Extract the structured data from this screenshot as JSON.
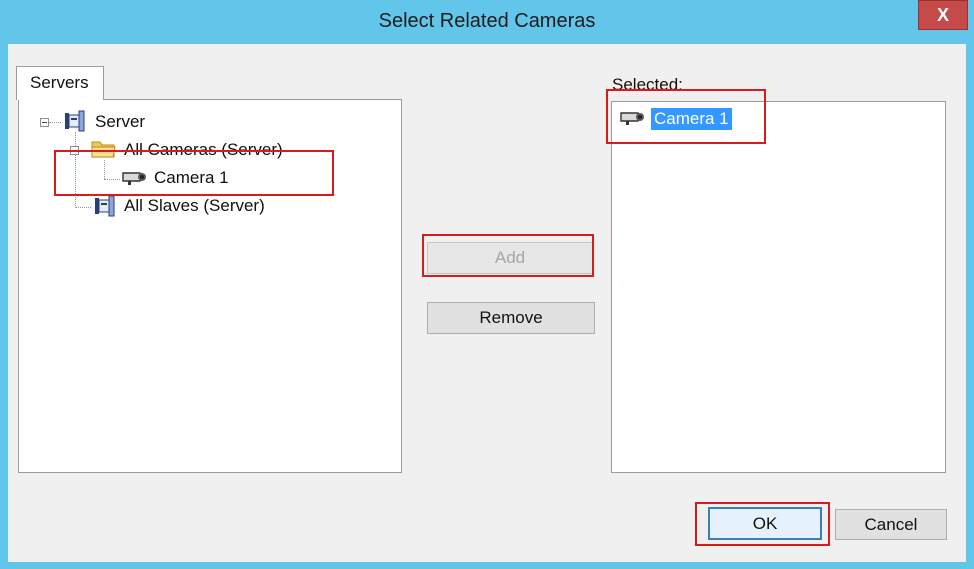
{
  "window": {
    "title": "Select Related Cameras",
    "close_glyph": "X",
    "accent_color": "#61c6ea"
  },
  "servers_tab": {
    "label": "Servers"
  },
  "tree": {
    "server": "Server",
    "all_cameras": "All Cameras (Server)",
    "camera": "Camera 1",
    "all_slaves": "All Slaves (Server)"
  },
  "buttons": {
    "add": "Add",
    "remove": "Remove",
    "ok": "OK",
    "cancel": "Cancel"
  },
  "selected": {
    "label": "Selected:",
    "items": [
      "Camera 1"
    ]
  },
  "icons": {
    "server": "server-icon",
    "folder": "folder-icon",
    "camera": "camera-icon"
  }
}
